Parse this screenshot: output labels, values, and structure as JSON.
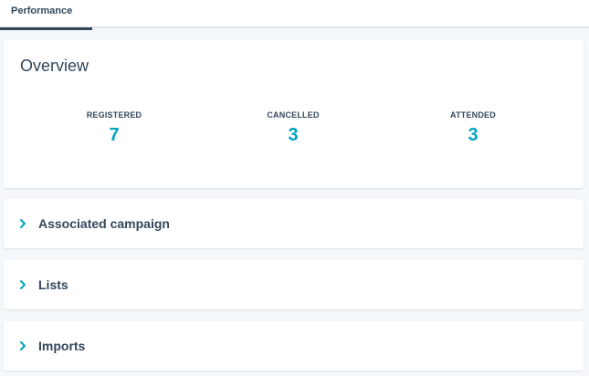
{
  "tabs": [
    {
      "label": "Performance",
      "active": true
    }
  ],
  "overview": {
    "title": "Overview",
    "stats": [
      {
        "label": "REGISTERED",
        "value": "7"
      },
      {
        "label": "CANCELLED",
        "value": "3"
      },
      {
        "label": "ATTENDED",
        "value": "3"
      }
    ]
  },
  "sections": [
    {
      "title": "Associated campaign",
      "icon": "chevron-right-icon",
      "expanded": false
    },
    {
      "title": "Lists",
      "icon": "chevron-right-icon",
      "expanded": false
    },
    {
      "title": "Imports",
      "icon": "chevron-right-icon",
      "expanded": false
    }
  ],
  "colors": {
    "accent": "#00a4bd",
    "text": "#33475b",
    "background": "#f5f8fa",
    "card": "#ffffff"
  }
}
